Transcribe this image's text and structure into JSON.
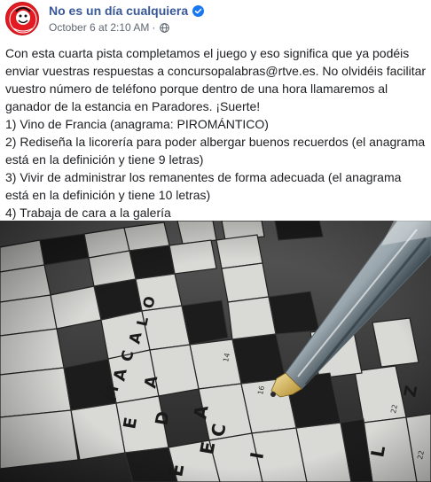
{
  "post": {
    "author": "No es un día cualquiera",
    "timestamp": "October 6 at 2:10 AM",
    "separator": "·",
    "privacy_icon": "globe-icon",
    "verified_icon": "verified-badge-icon",
    "avatar_text": "No es un día cualquiera",
    "paragraphs": [
      "Con esta cuarta pista completamos el juego y eso significa que ya podéis enviar vuestras respuestas a concursopalabras@rtve.es. No olvidéis facilitar vuestro número de teléfono porque dentro de una hora llamaremos al ganador de la estancia en Paradores. ¡Suerte!",
      "1) Vino de Francia (anagrama: PIROMÁNTICO)",
      "2) Rediseña la licorería para poder albergar buenos recuerdos (el anagrama está en la definición y tiene 9 letras)",
      "3) Vivir de administrar los remanentes de forma adecuada (el anagrama está en la definición y tiene 10 letras)",
      "4) Trabaja de cara a la galería"
    ]
  },
  "photo": {
    "letters": [
      "M",
      "A",
      "C",
      "A",
      "L",
      "O",
      "D",
      "A",
      "E",
      "C",
      "E",
      "I",
      "L",
      "Z",
      "R",
      "A",
      "E"
    ],
    "numbers": [
      "14",
      "16",
      "22",
      "22"
    ]
  },
  "colors": {
    "link": "#385898",
    "meta": "#606770",
    "text": "#1c1e21",
    "avatar_red": "#e21b22",
    "verified_blue": "#1877f2"
  }
}
